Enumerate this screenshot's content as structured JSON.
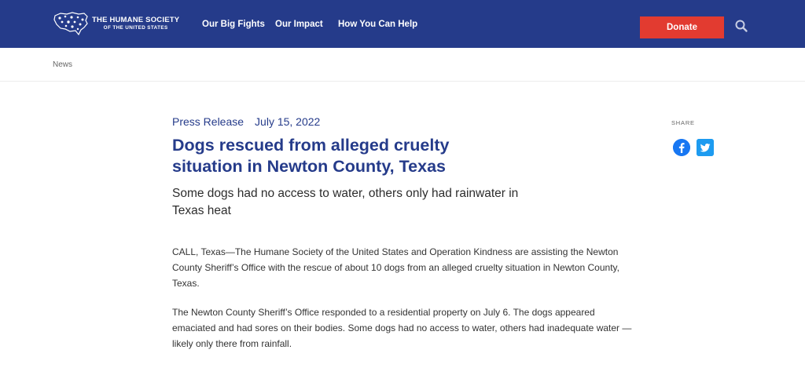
{
  "header": {
    "logo": {
      "line1": "THE HUMANE SOCIETY",
      "line2": "OF THE UNITED STATES"
    },
    "nav": [
      {
        "label": "Our Big Fights"
      },
      {
        "label": "Our Impact"
      },
      {
        "label": "How You Can Help"
      }
    ],
    "donate_label": "Donate",
    "search_icon": "search-icon"
  },
  "breadcrumb": {
    "label": "News"
  },
  "article": {
    "type": "Press Release",
    "date": "July 15, 2022",
    "title": "Dogs rescued from alleged cruelty situation in Newton County, Texas",
    "subtitle": "Some dogs had no access to water, others only had rainwater in Texas heat",
    "paragraphs": [
      "CALL, Texas—The Humane Society of the United States and Operation Kindness are assisting the Newton County Sheriff’s Office with the rescue of about 10 dogs from an alleged cruelty situation in Newton County, Texas.",
      "The Newton County Sheriff’s Office responded to a residential property on July 6. The dogs appeared emaciated and had sores on their bodies. Some dogs had no access to water, others had inadequate water —likely only there from rainfall."
    ]
  },
  "share": {
    "label": "SHARE",
    "icons": [
      "facebook-icon",
      "twitter-icon"
    ]
  },
  "colors": {
    "header_bg": "#253b8a",
    "donate_bg": "#e23b30",
    "title": "#253b8a",
    "facebook": "#1877f2",
    "twitter": "#1d9bf0"
  }
}
